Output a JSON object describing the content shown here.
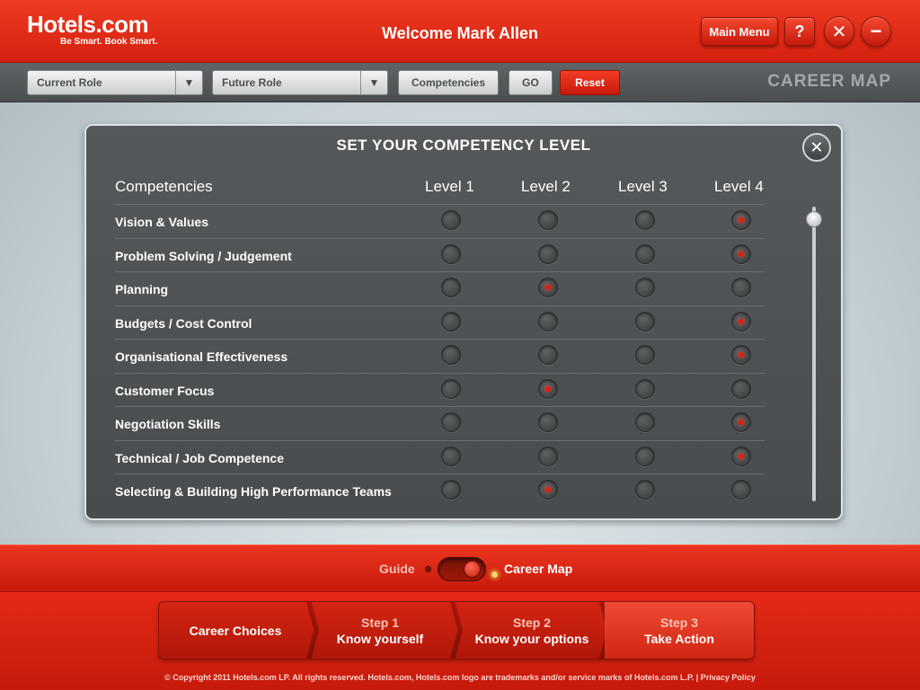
{
  "header": {
    "logo_brand": "Hotels.com",
    "logo_tagline": "Be Smart. Book Smart.",
    "welcome": "Welcome Mark Allen",
    "main_menu": "Main Menu",
    "help": "?",
    "close": "✕",
    "minimize": "−"
  },
  "toolbar": {
    "current_role": "Current Role",
    "future_role": "Future Role",
    "competencies": "Competencies",
    "go": "GO",
    "reset": "Reset",
    "title": "CAREER MAP",
    "dropdown_arrow": "▼"
  },
  "panel": {
    "title": "SET YOUR COMPETENCY LEVEL",
    "close": "✕",
    "columns": [
      "Competencies",
      "Level 1",
      "Level 2",
      "Level 3",
      "Level 4"
    ],
    "rows": [
      {
        "label": "Vision & Values",
        "selected_level": 4
      },
      {
        "label": "Problem Solving / Judgement",
        "selected_level": 4
      },
      {
        "label": "Planning",
        "selected_level": 2
      },
      {
        "label": "Budgets / Cost Control",
        "selected_level": 4
      },
      {
        "label": "Organisational Effectiveness",
        "selected_level": 4
      },
      {
        "label": "Customer Focus",
        "selected_level": 2
      },
      {
        "label": "Negotiation Skills",
        "selected_level": 4
      },
      {
        "label": "Technical / Job Competence",
        "selected_level": 4
      },
      {
        "label": "Selecting & Building High Performance Teams",
        "selected_level": 2
      }
    ]
  },
  "mode_toggle": {
    "guide": "Guide",
    "career_map": "Career Map",
    "active": "Career Map"
  },
  "steps": [
    {
      "number": "",
      "label": "Career Choices"
    },
    {
      "number": "Step 1",
      "label": "Know yourself"
    },
    {
      "number": "Step 2",
      "label": "Know your options"
    },
    {
      "number": "Step 3",
      "label": "Take Action"
    }
  ],
  "footer": {
    "copyright": "© Copyright 2011 Hotels.com LP.  All rights reserved. Hotels.com, Hotels.com logo are trademarks and/or service marks of Hotels.com L.P.  |   Privacy Policy"
  },
  "colors": {
    "brand_red": "#d5200f",
    "panel_bg": "#4e5254",
    "selected_dot": "#e41e0d"
  }
}
